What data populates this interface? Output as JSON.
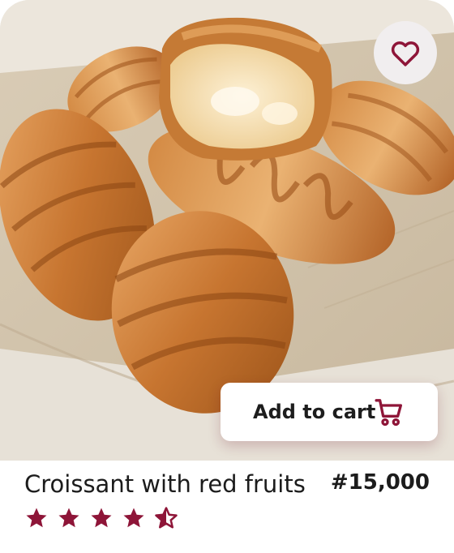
{
  "product": {
    "name": "Croissant with red fruits",
    "price": "#15,000",
    "rating": 4.5,
    "rating_max": 5,
    "image": "croissant-photo",
    "favorite": false
  },
  "actions": {
    "add_to_cart_label": "Add to cart",
    "cart_icon": "shopping-cart-icon",
    "favorite_icon": "heart-outline-icon"
  },
  "colors": {
    "accent": "#8e1538",
    "favorite_bg": "#f1eeef",
    "text": "#1c1c1c"
  }
}
